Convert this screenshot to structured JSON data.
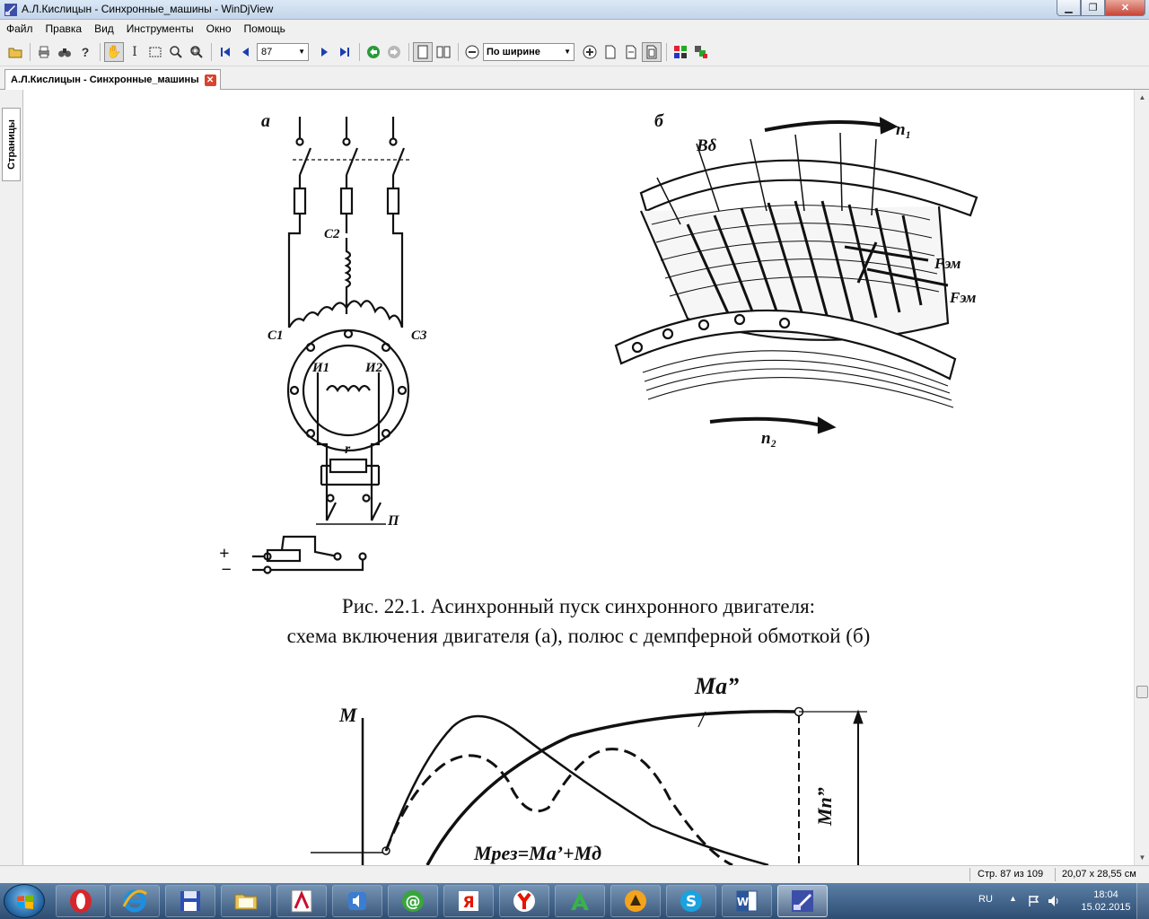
{
  "window": {
    "title": "А.Л.Кислицын - Синхронные_машины - WinDjView",
    "controls": [
      "minimize",
      "maximize",
      "close"
    ]
  },
  "menu": [
    "Файл",
    "Правка",
    "Вид",
    "Инструменты",
    "Окно",
    "Помощь"
  ],
  "toolbar": {
    "page_number": "87",
    "zoom": "По ширине"
  },
  "tab": {
    "label": "А.Л.Кислицын - Синхронные_машины"
  },
  "side_panel": {
    "tab_label": "Страницы"
  },
  "document": {
    "figure1": {
      "label_a": "а",
      "label_b": "б",
      "caption_line1": "Рис. 22.1. Асинхронный пуск синхронного двигателя:",
      "caption_line2": "схема включения двигателя (а), полюс с демпферной обмоткой (б)",
      "labels": {
        "c1": "С1",
        "c2": "С2",
        "c3": "С3",
        "i1": "И1",
        "i2": "И2",
        "r": "r",
        "p": "П",
        "plus": "+",
        "minus": "−",
        "b_delta": "Bδ",
        "n1": "n₁",
        "n2": "n₂",
        "f_em": "Fэм"
      }
    },
    "figure2": {
      "labels": {
        "m_axis": "M",
        "ma2": "Ma”",
        "m_res": "Mрез=Ma’+Mд",
        "mn": "Mn”"
      }
    }
  },
  "statusbar": {
    "page": "Стр. 87 из 109",
    "size": "20,07 x 28,55 см"
  },
  "taskbar": {
    "apps": [
      "opera",
      "internet-explorer",
      "save-disk",
      "file-explorer",
      "adobe-reader",
      "media-player",
      "icq",
      "yandex-ya",
      "yandex-browser",
      "acrobat",
      "aimp",
      "skype",
      "word",
      "windjview"
    ],
    "lang": "RU",
    "time": "18:04",
    "date": "15.02.2015"
  },
  "colors": {
    "taskbar": "#3a5f88",
    "close_button": "#c6463a"
  }
}
